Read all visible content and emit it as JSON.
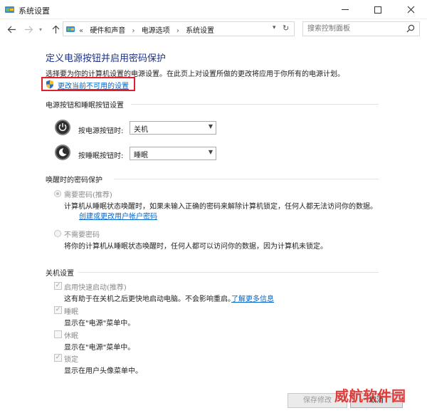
{
  "window": {
    "title": "系统设置"
  },
  "nav": {
    "breadcrumbs": [
      "硬件和声音",
      "电源选项",
      "系统设置"
    ],
    "search_placeholder": "搜索控制面板"
  },
  "page": {
    "heading": "定义电源按钮并启用密码保护",
    "description": "选择要为你的计算机设置的电源设置。在此页上对设置所做的更改将应用于你所有的电源计划。",
    "change_unavailable_link": "更改当前不可用的设置"
  },
  "buttons_section": {
    "title": "电源按钮和睡眠按钮设置",
    "power_label": "按电源按钮时:",
    "power_value": "关机",
    "sleep_label": "按睡眠按钮时:",
    "sleep_value": "睡眠"
  },
  "password_section": {
    "title": "唤醒时的密码保护",
    "require_label": "需要密码(推荐)",
    "require_desc": "计算机从睡眠状态唤醒时，如果未输入正确的密码来解除计算机锁定，任何人都无法访问你的数据。",
    "require_link": "创建或更改用户帐户密码",
    "norequire_label": "不需要密码",
    "norequire_desc": "将你的计算机从睡眠状态唤醒时，任何人都可以访问你的数据，因为计算机未锁定。"
  },
  "shutdown_section": {
    "title": "关机设置",
    "fast_startup_label": "启用快速启动(推荐)",
    "fast_startup_desc": "这有助于在关机之后更快地启动电脑。不会影响重启。",
    "fast_startup_link": "了解更多信息",
    "sleep_label": "睡眠",
    "sleep_desc": "显示在\"电源\"菜单中。",
    "hibernate_label": "休眠",
    "hibernate_desc": "显示在\"电源\"菜单中。",
    "lock_label": "锁定",
    "lock_desc": "显示在用户头像菜单中。"
  },
  "footer": {
    "save_label": "保存修改",
    "cancel_label": "取消"
  },
  "watermark": "威航软件园"
}
